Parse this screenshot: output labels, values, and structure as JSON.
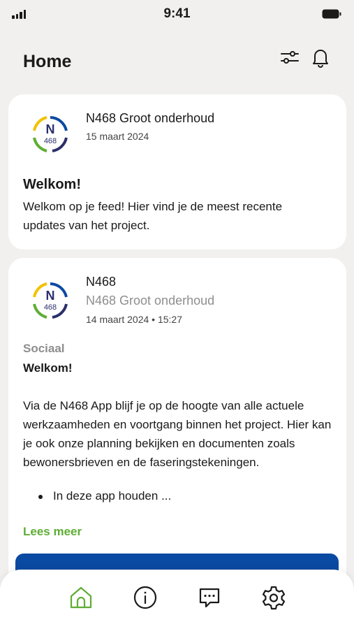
{
  "status_bar": {
    "time": "9:41"
  },
  "header": {
    "title": "Home",
    "filter_icon": "sliders-icon",
    "bell_icon": "bell-icon"
  },
  "brand": {
    "logo_top": "N",
    "logo_bottom": "468",
    "accent": "#5fad34",
    "primary": "#0b4aa2"
  },
  "card1": {
    "source": "N468 Groot onderhoud",
    "date": "15 maart 2024",
    "title": "Welkom!",
    "body": "Welkom op je feed! Hier vind je de meest recente updates van het project."
  },
  "card2": {
    "author": "N468",
    "source": "N468 Groot onderhoud",
    "date": "14 maart 2024 • 15:27",
    "category": "Sociaal",
    "title": "Welkom!",
    "body": "Via de N468 App blijf je op de hoogte van alle actuele werkzaamheden en voortgang binnen het project. Hier kan je ook onze planning bekijken en documenten zoals bewonersbrieven en de faseringstekeningen.",
    "bullet": "In deze app houden ...",
    "read_more": "Lees meer"
  },
  "tabbar": {
    "items": [
      {
        "icon": "home-icon",
        "active": true
      },
      {
        "icon": "info-icon",
        "active": false
      },
      {
        "icon": "chat-icon",
        "active": false
      },
      {
        "icon": "gear-icon",
        "active": false
      }
    ]
  }
}
